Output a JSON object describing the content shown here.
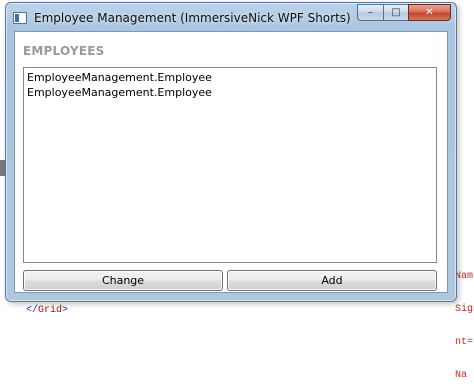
{
  "window": {
    "title": "Employee Management (ImmersiveNick WPF Shorts)",
    "buttons": {
      "minimize": "–",
      "maximize": "□",
      "close": "✕"
    }
  },
  "main": {
    "section_title": "EMPLOYEES",
    "employees": [
      "EmployeeManagement.Employee",
      "EmployeeManagement.Employee"
    ],
    "change_label": "Change",
    "add_label": "Add"
  },
  "background": {
    "grid_open": "</",
    "grid_name": "Grid",
    "grid_close": ">",
    "right_lines": [
      "Nam",
      "Sign",
      "nt=\"",
      "Na"
    ]
  }
}
